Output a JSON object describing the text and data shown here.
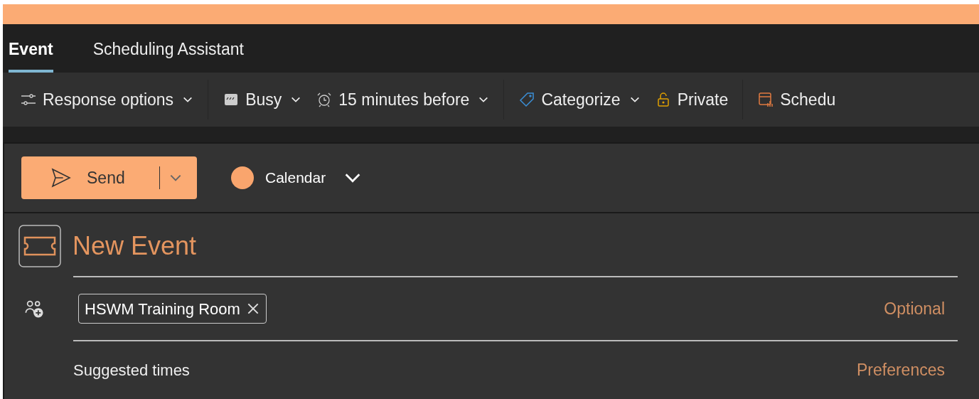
{
  "tabs": [
    {
      "label": "Event",
      "selected": true
    },
    {
      "label": "Scheduling Assistant",
      "selected": false
    }
  ],
  "toolbar": [
    {
      "kind": "sliders",
      "label": "Response options",
      "dropdown": true
    },
    {
      "kind": "busy",
      "label": "Busy",
      "dropdown": true
    },
    {
      "kind": "alarm",
      "label": "15 minutes before",
      "dropdown": true
    },
    {
      "kind": "tag",
      "label": "Categorize",
      "dropdown": true
    },
    {
      "kind": "lock",
      "label": "Private",
      "dropdown": false
    },
    {
      "kind": "schedule",
      "label": "Schedu",
      "dropdown": false
    }
  ],
  "send_button": {
    "label": "Send"
  },
  "calendar_picker": {
    "label": "Calendar",
    "color": "#f9a56d"
  },
  "title": {
    "value": "New Event"
  },
  "attendees": [
    {
      "label": "HSWM Training Room"
    }
  ],
  "optional_link": "Optional",
  "suggested_times": "Suggested times",
  "preferences_link": "Preferences"
}
